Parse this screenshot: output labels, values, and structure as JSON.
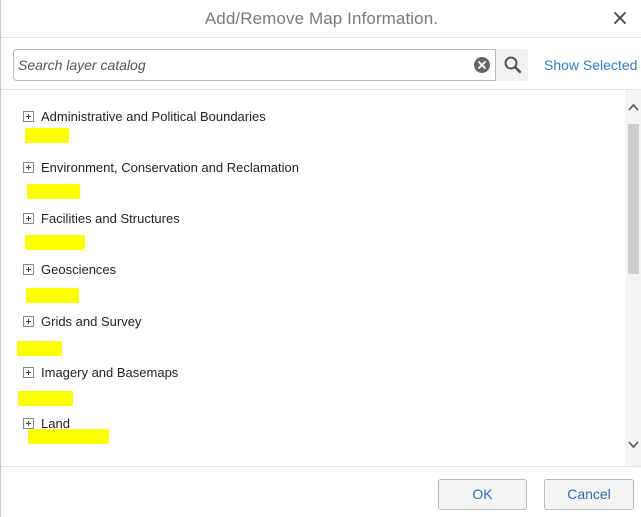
{
  "dialog": {
    "title": "Add/Remove Map Information.",
    "close_icon": "close-icon"
  },
  "search": {
    "placeholder": "Search layer catalog",
    "value": "",
    "clear_icon": "clear-circle-icon",
    "search_icon": "magnifier-icon",
    "show_selected_label": "Show Selected"
  },
  "tree": {
    "items": [
      {
        "label": "Administrative and Political Boundaries"
      },
      {
        "label": "Environment, Conservation and Reclamation"
      },
      {
        "label": "Facilities and Structures"
      },
      {
        "label": "Geosciences"
      },
      {
        "label": "Grids and Survey"
      },
      {
        "label": "Imagery and Basemaps"
      },
      {
        "label": "Land"
      }
    ]
  },
  "footer": {
    "ok_label": "OK",
    "cancel_label": "Cancel"
  },
  "colors": {
    "accent": "#2e7fc0",
    "highlight": "#ffff00",
    "title": "#7a7a7a"
  }
}
